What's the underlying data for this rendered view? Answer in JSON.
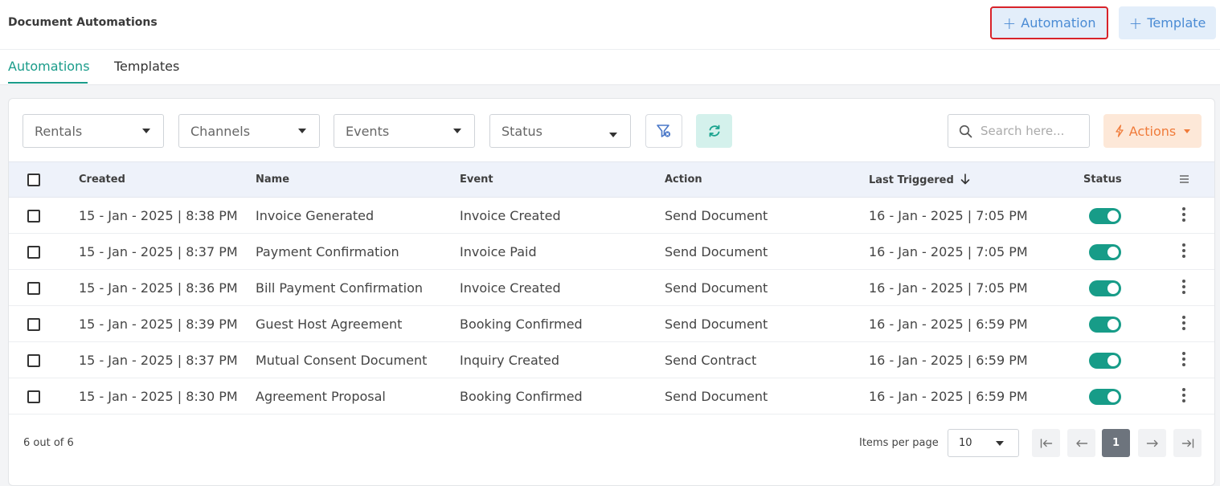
{
  "header": {
    "title": "Document Automations",
    "add_automation": "Automation",
    "add_template": "Template"
  },
  "tabs": [
    {
      "label": "Automations",
      "active": true
    },
    {
      "label": "Templates",
      "active": false
    }
  ],
  "filters": {
    "rentals": "Rentals",
    "channels": "Channels",
    "events": "Events",
    "status": "Status",
    "search_placeholder": "Search here...",
    "actions": "Actions"
  },
  "table": {
    "columns": [
      "Created",
      "Name",
      "Event",
      "Action",
      "Last Triggered",
      "Status"
    ],
    "rows": [
      {
        "created": "15 - Jan - 2025 | 8:38 PM",
        "name": "Invoice Generated",
        "event": "Invoice Created",
        "action": "Send Document",
        "last_triggered": "16 - Jan - 2025 | 7:05 PM",
        "status": true
      },
      {
        "created": "15 - Jan - 2025 | 8:37 PM",
        "name": "Payment Confirmation",
        "event": "Invoice Paid",
        "action": "Send Document",
        "last_triggered": "16 - Jan - 2025 | 7:05 PM",
        "status": true
      },
      {
        "created": "15 - Jan - 2025 | 8:36 PM",
        "name": "Bill Payment Confirmation",
        "event": "Invoice Created",
        "action": "Send Document",
        "last_triggered": "16 - Jan - 2025 | 7:05 PM",
        "status": true
      },
      {
        "created": "15 - Jan - 2025 | 8:39 PM",
        "name": "Guest Host Agreement",
        "event": "Booking Confirmed",
        "action": "Send Document",
        "last_triggered": "16 - Jan - 2025 | 6:59 PM",
        "status": true
      },
      {
        "created": "15 - Jan - 2025 | 8:37 PM",
        "name": "Mutual Consent Document",
        "event": "Inquiry Created",
        "action": "Send Contract",
        "last_triggered": "16 - Jan - 2025 | 6:59 PM",
        "status": true
      },
      {
        "created": "15 - Jan - 2025 | 8:30 PM",
        "name": "Agreement Proposal",
        "event": "Booking Confirmed",
        "action": "Send Document",
        "last_triggered": "16 - Jan - 2025 | 6:59 PM",
        "status": true
      }
    ]
  },
  "footer": {
    "count": "6 out of 6",
    "items_per_page_label": "Items per page",
    "items_per_page": "10",
    "current_page": "1"
  },
  "colors": {
    "accent": "#1a9c8a",
    "highlight_border": "#d8232a",
    "action_orange": "#f07b3a",
    "button_blue": "#4a8bd4"
  }
}
